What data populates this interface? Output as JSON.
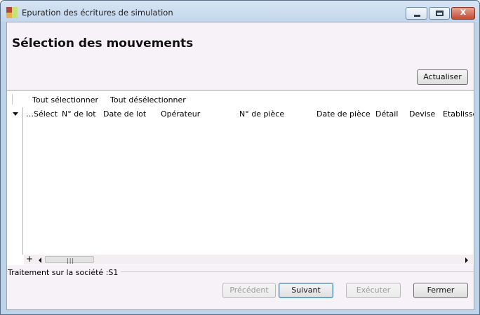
{
  "window": {
    "title": "Epuration des écritures de simulation",
    "close_glyph": "x"
  },
  "page": {
    "heading": "Sélection des mouvements"
  },
  "actions": {
    "refresh_label": "Actualiser"
  },
  "toolbar": {
    "select_all": "Tout sélectionner",
    "deselect_all": "Tout désélectionner"
  },
  "grid": {
    "columns": [
      "…Sélecti",
      "N° de lot",
      "Date de lot",
      "Opérateur",
      "N° de pièce",
      "Date de pièce",
      "Détail",
      "Devise",
      "Etablisse"
    ],
    "rows": [],
    "footer_plus": "+",
    "scroll_grip": "|||"
  },
  "status": {
    "company_label": "Traitement sur la société :S1"
  },
  "footer": {
    "previous": "Précédent",
    "next": "Suivant",
    "execute": "Exécuter",
    "close": "Fermer"
  },
  "icons": {
    "app": "app-icon",
    "minimize": "minimize-icon",
    "maximize": "maximize-icon",
    "close": "close-icon",
    "expand": "triangle-down-icon"
  },
  "colors": {
    "titlebar": "#c9dbee",
    "client_bg": "#f7f2f7",
    "close_button": "#c24b33"
  }
}
